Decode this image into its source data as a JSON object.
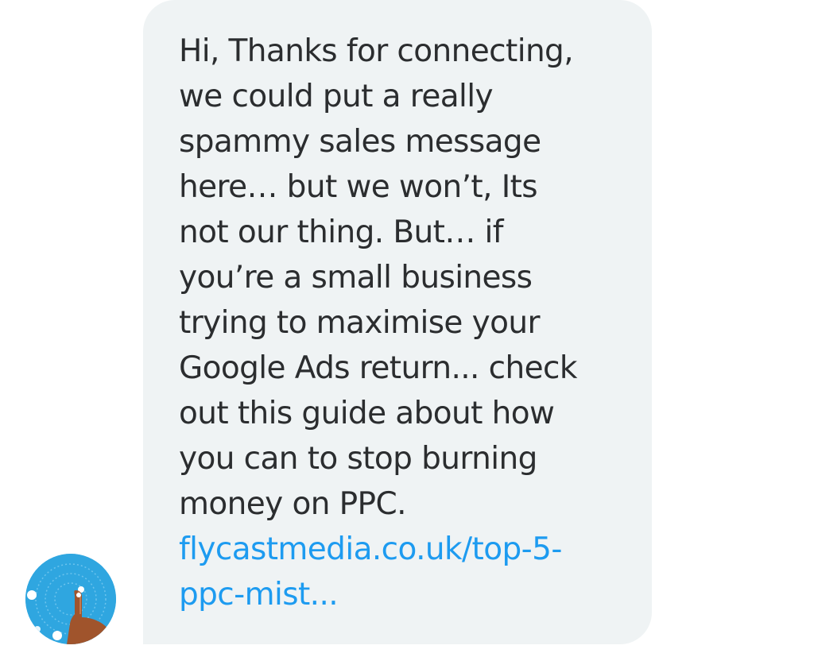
{
  "message": {
    "text": "Hi, Thanks for connecting,\nwe could put a really\nspammy sales message\nhere… but we won’t, Its\nnot our thing. But… if\nyou’re a small business\ntrying to maximise your\nGoogle Ads return... check\nout this guide about how\nyou can to stop burning\nmoney on PPC.",
    "link_text": "flycastmedia.co.uk/top-5-\nppc-mist...",
    "link_color": "#1d9bf0",
    "bubble_color": "#eff3f4"
  },
  "sender": {
    "avatar_icon": "fingertip-touch-icon",
    "avatar_color": "#2fa6e0"
  }
}
